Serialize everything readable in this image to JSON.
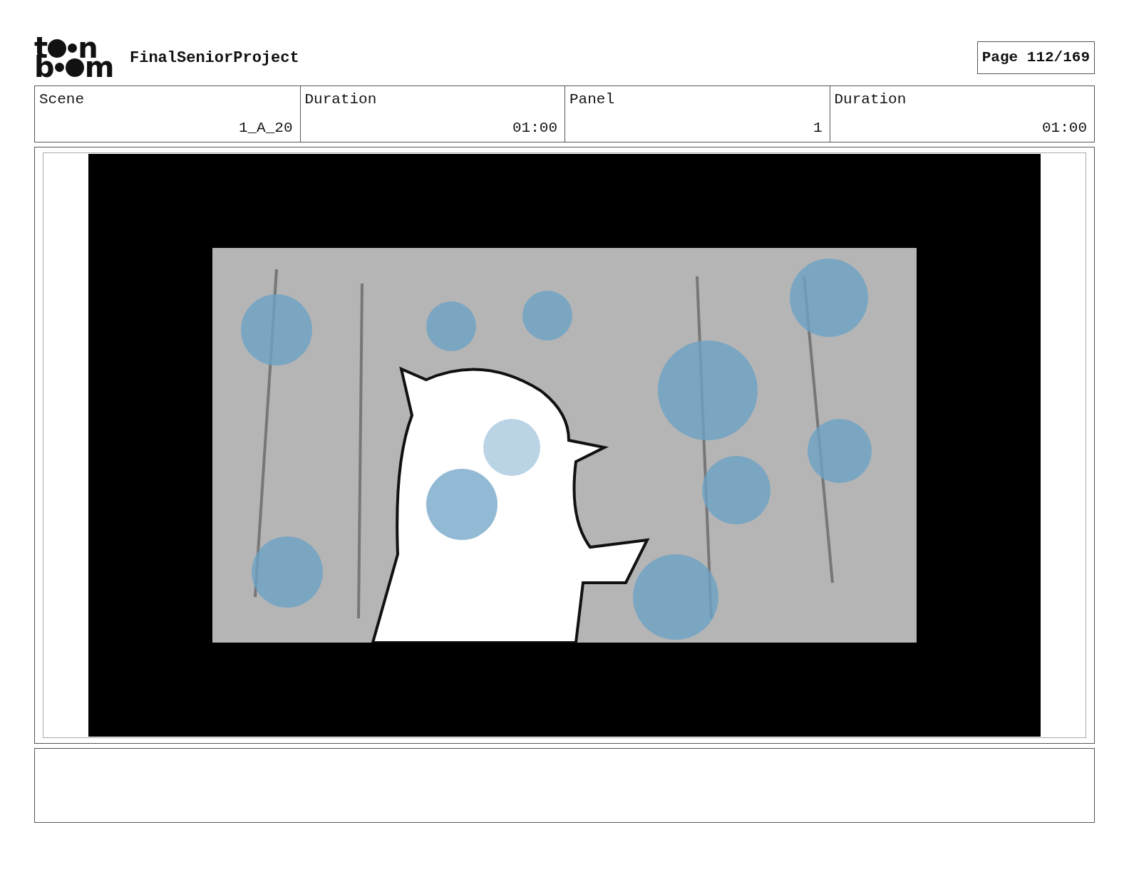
{
  "logo": {
    "rows": [
      [
        "t",
        "n"
      ],
      [
        "b",
        "m"
      ]
    ]
  },
  "project_title": "FinalSeniorProject",
  "page_label": "Page 112/169",
  "info_table": {
    "headings": [
      "Scene",
      "Duration",
      "Panel",
      "Duration"
    ],
    "values": [
      "1_A_20",
      "01:00",
      "1",
      "01:00"
    ]
  }
}
